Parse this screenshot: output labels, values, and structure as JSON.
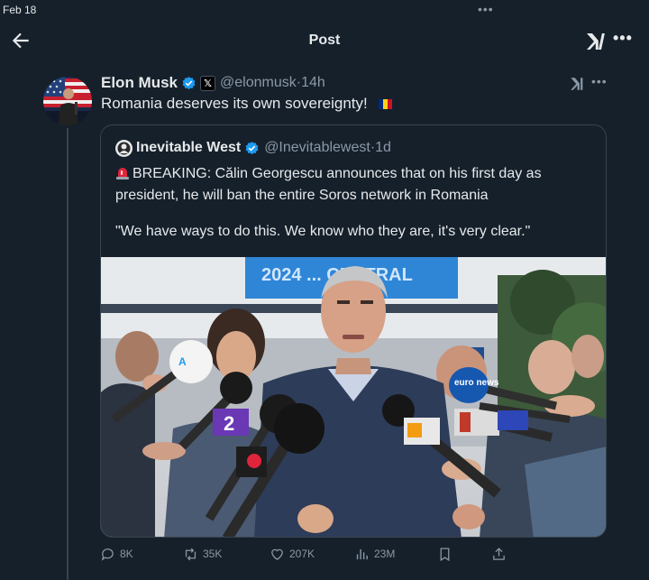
{
  "statusbar": {
    "date": "Feb 18",
    "dots": "•••"
  },
  "header": {
    "title": "Post"
  },
  "post": {
    "author_name": "Elon Musk",
    "author_handle": "@elonmusk",
    "time": "14h",
    "text": "Romania deserves its own sovereignty!"
  },
  "quote": {
    "author_name": "Inevitable West",
    "author_handle": "@Inevitablewest",
    "time": "1d",
    "text_1": "BREAKING: Călin Georgescu announces that on his first day as president, he will ban the entire Soros network in Romania",
    "text_2": "\"We have ways to do this. We know who they are, it's very clear.\"",
    "image_banner_text": "2024 ... CENTRAL",
    "mic_label_euronews": "euro news",
    "mic_label_channel": "2"
  },
  "actions": {
    "replies": "8K",
    "reposts": "35K",
    "likes": "207K",
    "views": "23M"
  },
  "colors": {
    "background": "#15202b",
    "verified": "#1d9bf0",
    "secondary_text": "#8b98a5",
    "border": "#38444d"
  },
  "icons": [
    "back-arrow-icon",
    "grok-icon",
    "more-icon",
    "verified-badge-icon",
    "x-logo-icon",
    "romania-flag-icon",
    "siren-icon",
    "reply-icon",
    "repost-icon",
    "like-icon",
    "views-icon",
    "bookmark-icon",
    "share-icon"
  ]
}
